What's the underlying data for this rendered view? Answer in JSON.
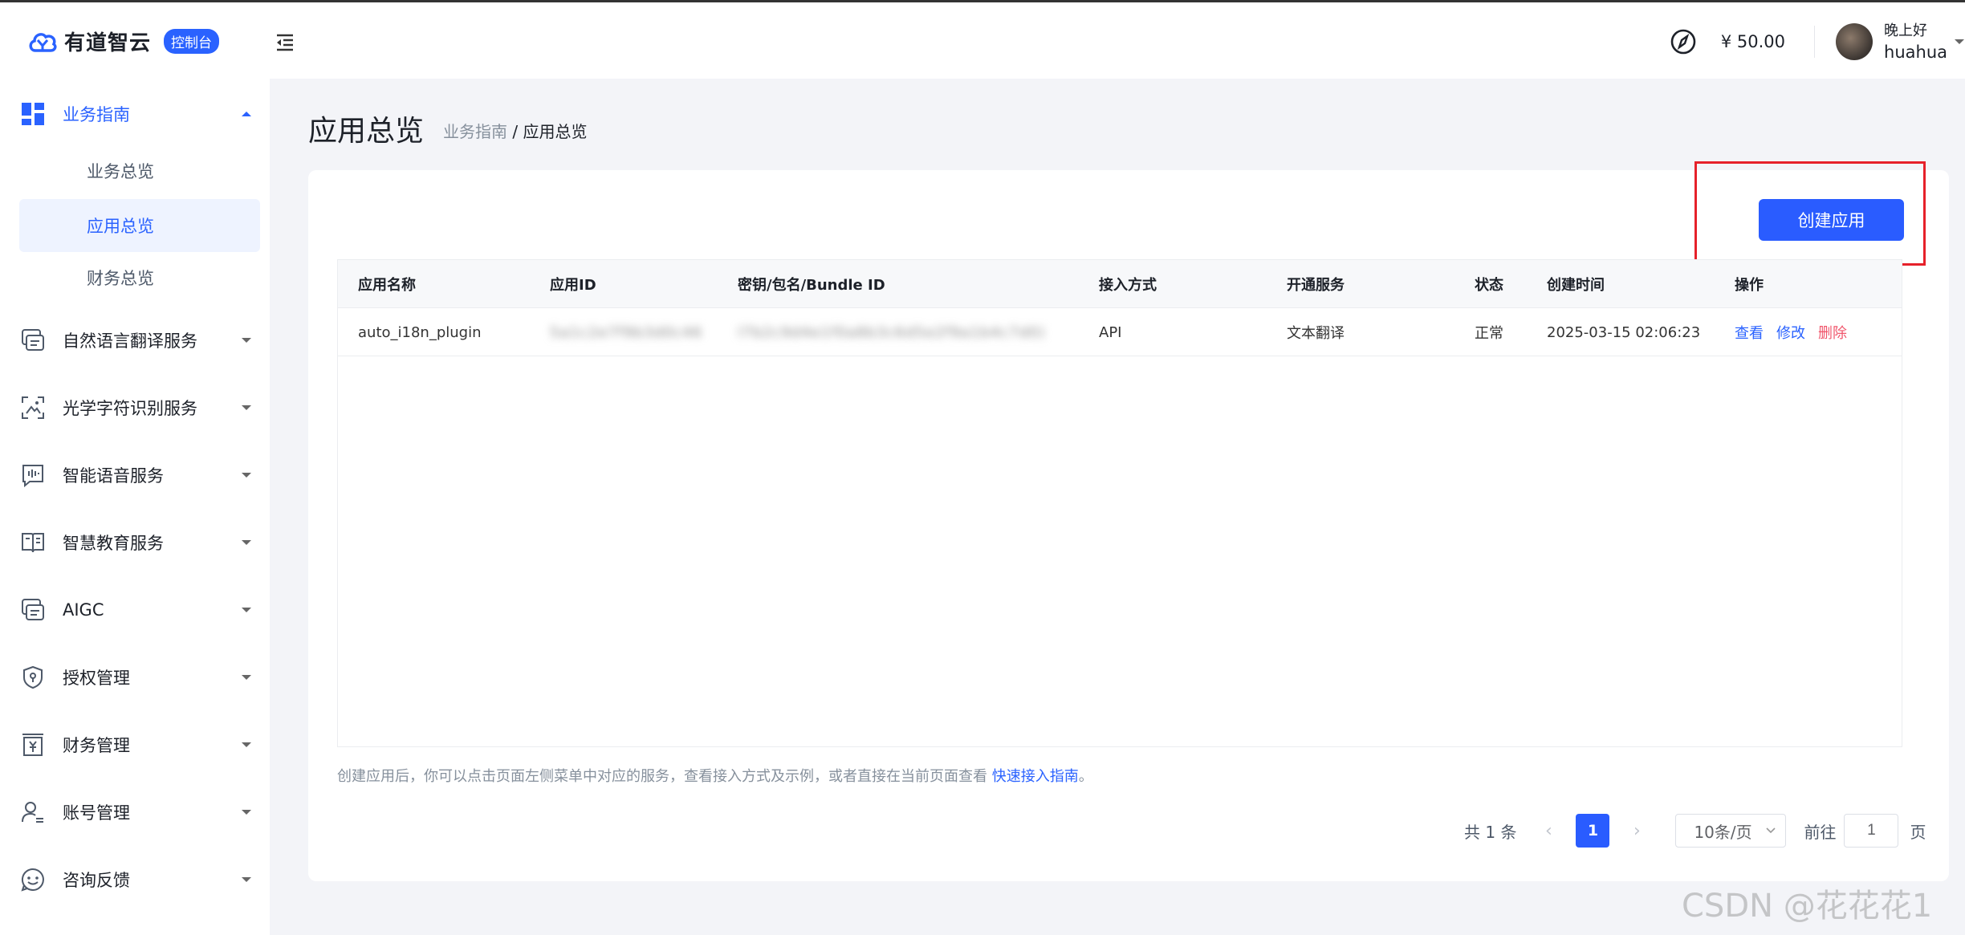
{
  "header": {
    "logo_text": "有道智云",
    "badge": "控制台",
    "balance": "¥ 50.00",
    "greeting": "晚上好",
    "username": "huahua"
  },
  "sidebar": {
    "groups": [
      {
        "label": "业务指南",
        "icon": "dashboard-grid-icon",
        "active": true
      },
      {
        "label": "自然语言翻译服务",
        "icon": "chat-translate-icon"
      },
      {
        "label": "光学字符识别服务",
        "icon": "scan-icon"
      },
      {
        "label": "智能语音服务",
        "icon": "voice-wave-icon"
      },
      {
        "label": "智慧教育服务",
        "icon": "book-icon"
      },
      {
        "label": "AIGC",
        "icon": "chat-stack-icon"
      },
      {
        "label": "授权管理",
        "icon": "shield-icon"
      },
      {
        "label": "财务管理",
        "icon": "yuan-document-icon"
      },
      {
        "label": "账号管理",
        "icon": "user-settings-icon"
      },
      {
        "label": "咨询反馈",
        "icon": "smile-icon"
      }
    ],
    "sub_items": [
      {
        "label": "业务总览"
      },
      {
        "label": "应用总览",
        "selected": true
      },
      {
        "label": "财务总览"
      }
    ]
  },
  "main": {
    "title": "应用总览",
    "breadcrumb_parent": "业务指南",
    "breadcrumb_sep": " / ",
    "breadcrumb_current": "应用总览",
    "create_button": "创建应用",
    "table": {
      "headers": [
        "应用名称",
        "应用ID",
        "密钥/包名/Bundle ID",
        "接入方式",
        "开通服务",
        "状态",
        "创建时间",
        "操作"
      ],
      "rows": [
        {
          "name": "auto_i18n_plugin",
          "app_id": "5a1c2e7f9b3d0c46",
          "secret": "l7b2c9d4e1f0a8b3c6d5e2f9a1b4c7d0)",
          "access": "API",
          "service": "文本翻译",
          "status": "正常",
          "created": "2025-03-15 02:06:23",
          "op_view": "查看",
          "op_edit": "修改",
          "op_delete": "删除"
        }
      ]
    },
    "hint_text": "创建应用后，你可以点击页面左侧菜单中对应的服务，查看接入方式及示例，或者直接在当前页面查看 ",
    "hint_link": "快速接入指南",
    "hint_end": "。",
    "pagination": {
      "total": "共 1 条",
      "current_page": "1",
      "page_size": "10条/页",
      "goto_label": "前往",
      "goto_value": "1",
      "page_unit": "页"
    }
  },
  "watermark": "CSDN @花花花1",
  "colors": {
    "accent": "#2a5cff",
    "danger": "#f0556b",
    "highlight": "#e6212a"
  }
}
